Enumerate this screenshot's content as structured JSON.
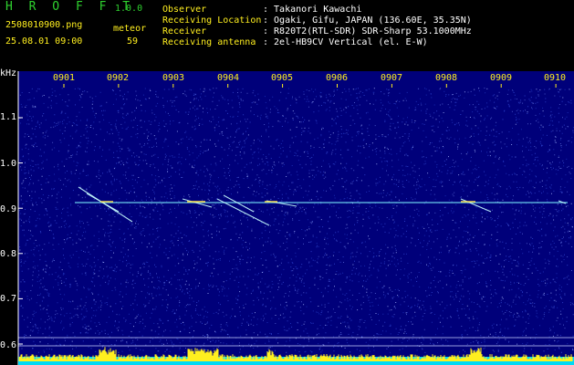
{
  "app": {
    "name": "H R O F F T",
    "version": "1.0.0"
  },
  "file": {
    "filename": "2508010900.png",
    "datetime": "25.08.01 09:00",
    "meteor_label": "meteor",
    "meteor_count": "59"
  },
  "info": [
    {
      "label": "Observer",
      "value": ": Takanori Kawachi"
    },
    {
      "label": "Receiving Location",
      "value": ": Ogaki, Gifu, JAPAN (136.60E, 35.35N)"
    },
    {
      "label": "Receiver",
      "value": ": R820T2(RTL-SDR) SDR-Sharp 53.1000MHz"
    },
    {
      "label": "Receiving antenna",
      "value": ": 2el-HB9CV Vertical (el. E-W)"
    }
  ],
  "axis": {
    "unit": "kHz",
    "time_ticks": [
      "0901",
      "0902",
      "0903",
      "0904",
      "0905",
      "0906",
      "0907",
      "0908",
      "0909",
      "0910"
    ],
    "freq_ticks": [
      "1.1",
      "1.0",
      "0.9",
      "0.8",
      "0.7",
      "0.6"
    ]
  },
  "colors": {
    "background": "#00007a",
    "noise": "#4a6cff",
    "carrier": "#7cf0ff",
    "meteor_echo": "#c8ffff",
    "level_bar": "#ffef1f",
    "level_base": "#00e5ff"
  }
}
